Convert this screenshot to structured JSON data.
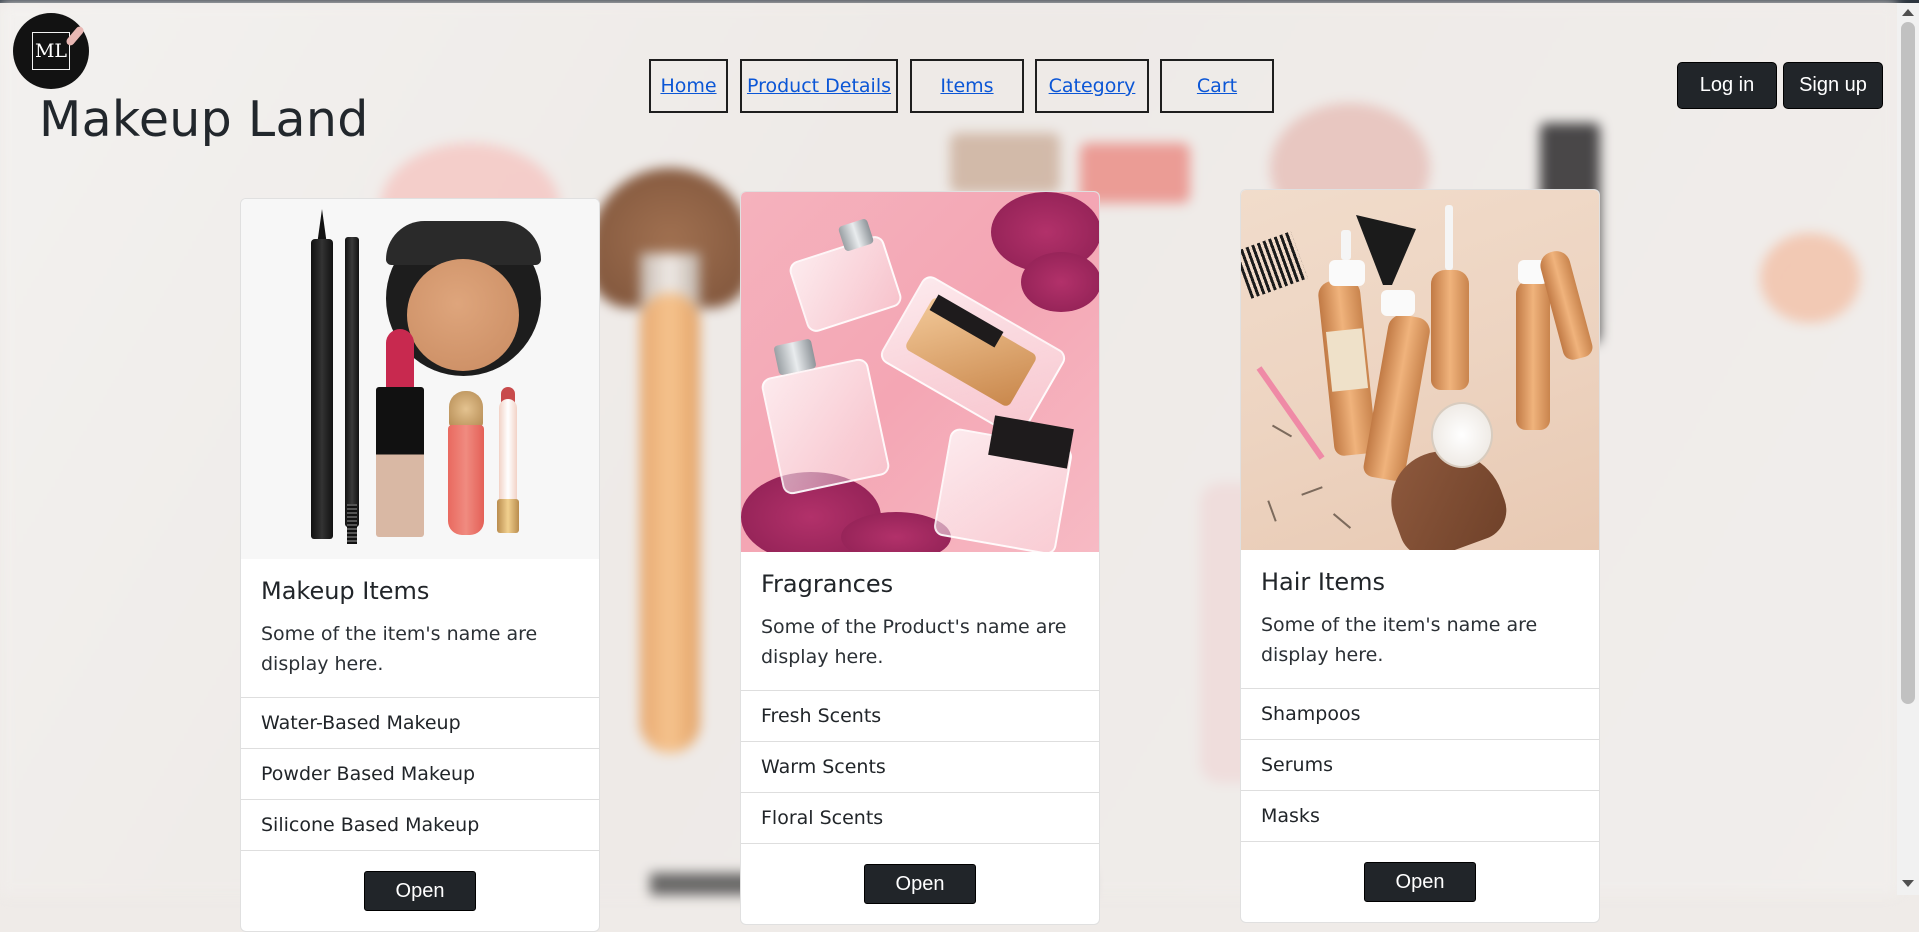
{
  "header": {
    "logo_text": "ML",
    "title": "Makeup Land"
  },
  "nav": {
    "items": [
      {
        "label": "Home"
      },
      {
        "label": "Product Details"
      },
      {
        "label": "Items"
      },
      {
        "label": "Category"
      },
      {
        "label": "Cart"
      }
    ]
  },
  "auth": {
    "login_label": "Log in",
    "signup_label": "Sign up"
  },
  "cards": [
    {
      "title": "Makeup Items",
      "text": "Some of the item's name are display here.",
      "items": [
        "Water-Based Makeup",
        "Powder Based Makeup",
        "Silicone Based Makeup"
      ],
      "button_label": "Open"
    },
    {
      "title": "Fragrances",
      "text": "Some of the Product's name are display here.",
      "items": [
        "Fresh Scents",
        "Warm Scents",
        "Floral Scents"
      ],
      "button_label": "Open"
    },
    {
      "title": "Hair Items",
      "text": "Some of the item's name are display here.",
      "items": [
        "Shampoos",
        "Serums",
        "Masks"
      ],
      "button_label": "Open"
    }
  ],
  "colors": {
    "dark_button": "#212529",
    "nav_link": "#0b56d6",
    "text": "#212529"
  }
}
